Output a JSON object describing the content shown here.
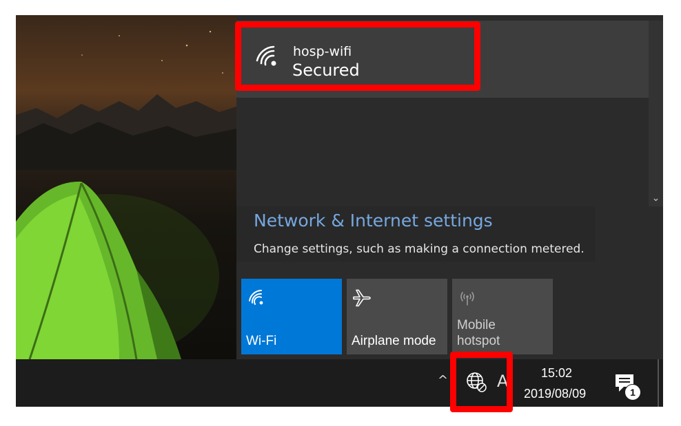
{
  "network_list": {
    "item": {
      "name": "hosp-wifi",
      "status": "Secured",
      "icon": "wifi-signal-icon"
    },
    "scroll_icon": "chevron-down-icon",
    "scroll_glyph": "⌄"
  },
  "settings": {
    "link": "Network & Internet settings",
    "description": "Change settings, such as making a connection metered."
  },
  "quick_actions": [
    {
      "label": "Wi-Fi",
      "icon": "wifi-icon",
      "active": true
    },
    {
      "label": "Airplane mode",
      "icon": "airplane-icon",
      "active": false
    },
    {
      "label": "Mobile hotspot",
      "icon": "hotspot-icon",
      "active": false
    }
  ],
  "taskbar": {
    "chevron_glyph": "^",
    "network_icon": "globe-no-connection-icon",
    "partial_glyph": "A",
    "time": "15:02",
    "date": "2019/08/09",
    "action_center_icon": "action-center-icon",
    "notification_count": "1"
  },
  "colors": {
    "accent": "#0078d7",
    "link": "#76a8e0",
    "highlight": "#ff0000",
    "panel": "#2b2b2b"
  }
}
